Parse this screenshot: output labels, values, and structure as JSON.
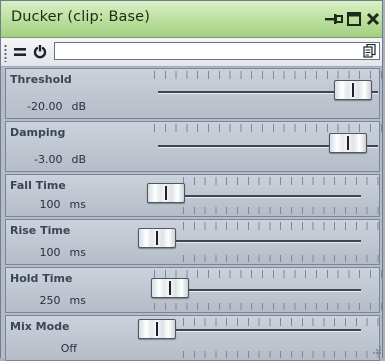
{
  "window": {
    "title": "Ducker (clip: Base)"
  },
  "toolbar": {
    "preset_value": ""
  },
  "params": [
    {
      "name": "Threshold",
      "value": "-20.00",
      "unit": "dB",
      "level": 0.95
    },
    {
      "name": "Damping",
      "value": "-3.00",
      "unit": "dB",
      "level": 0.93
    },
    {
      "name": "Fall Time",
      "value": "100",
      "unit": "ms",
      "level": 0.06
    },
    {
      "name": "Rise Time",
      "value": "100",
      "unit": "ms",
      "level": 0.02
    },
    {
      "name": "Hold Time",
      "value": "250",
      "unit": "ms",
      "level": 0.08
    },
    {
      "name": "Mix Mode",
      "value": "Off",
      "unit": "",
      "level": 0.02
    }
  ],
  "colors": {
    "titlebar": "#bfe2a3",
    "panel": "#c4cad4",
    "accent": "#3e4654"
  },
  "icons": {
    "pin": "pin-icon",
    "maximize": "maximize-icon",
    "close": "close-icon",
    "menu": "menu-icon",
    "power": "power-icon",
    "preset": "preset-icon"
  }
}
